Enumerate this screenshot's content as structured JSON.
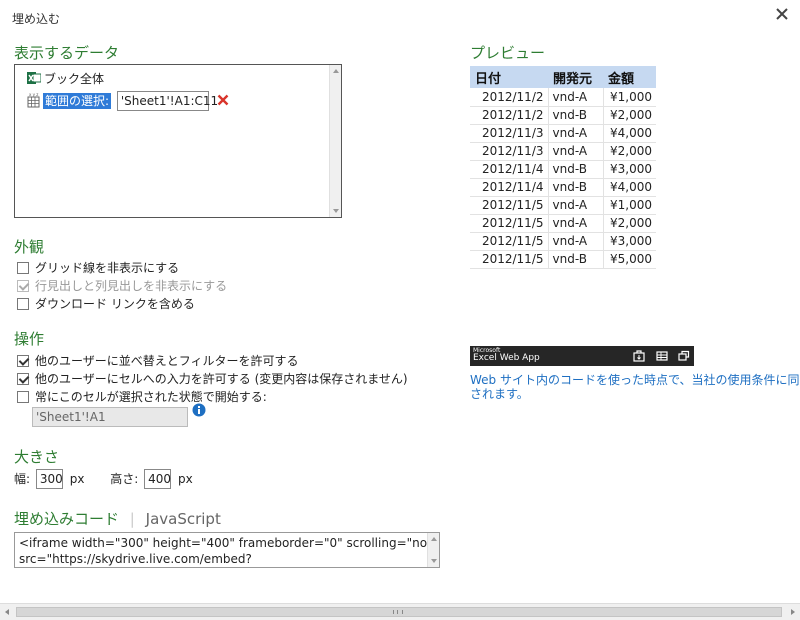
{
  "dialog": {
    "title": "埋め込む"
  },
  "data_section": {
    "heading": "表示するデータ",
    "items": [
      {
        "label": "ブック全体"
      },
      {
        "label": "範囲の選択:",
        "value": "'Sheet1'!A1:C11"
      }
    ]
  },
  "appearance": {
    "heading": "外観",
    "options": [
      {
        "label": "グリッド線を非表示にする",
        "checked": false,
        "disabled": false
      },
      {
        "label": "行見出しと列見出しを非表示にする",
        "checked": true,
        "disabled": true
      },
      {
        "label": "ダウンロード リンクを含める",
        "checked": false,
        "disabled": false
      }
    ]
  },
  "interaction": {
    "heading": "操作",
    "options": [
      {
        "label": "他のユーザーに並べ替えとフィルターを許可する",
        "checked": true
      },
      {
        "label": "他のユーザーにセルへの入力を許可する (変更内容は保存されません)",
        "checked": true
      },
      {
        "label": "常にこのセルが選択された状態で開始する:",
        "checked": false
      }
    ],
    "start_cell": "'Sheet1'!A1"
  },
  "size": {
    "heading": "大きさ",
    "width_label": "幅:",
    "width_value": "300",
    "height_label": "高さ:",
    "height_value": "400",
    "unit": "px"
  },
  "embed_code": {
    "tab_active": "埋め込みコード",
    "tab_other": "JavaScript",
    "code_line1": "<iframe width=\"300\" height=\"400\" frameborder=\"0\" scrolling=\"no\"",
    "code_line2": "src=\"https://skydrive.live.com/embed?"
  },
  "preview": {
    "heading": "プレビュー",
    "columns": [
      "日付",
      "開発元",
      "金額"
    ],
    "rows": [
      [
        "2012/11/2",
        "vnd-A",
        "¥1,000"
      ],
      [
        "2012/11/2",
        "vnd-B",
        "¥2,000"
      ],
      [
        "2012/11/3",
        "vnd-A",
        "¥4,000"
      ],
      [
        "2012/11/3",
        "vnd-A",
        "¥2,000"
      ],
      [
        "2012/11/4",
        "vnd-B",
        "¥3,000"
      ],
      [
        "2012/11/4",
        "vnd-B",
        "¥4,000"
      ],
      [
        "2012/11/5",
        "vnd-A",
        "¥1,000"
      ],
      [
        "2012/11/5",
        "vnd-A",
        "¥2,000"
      ],
      [
        "2012/11/5",
        "vnd-A",
        "¥3,000"
      ],
      [
        "2012/11/5",
        "vnd-B",
        "¥5,000"
      ]
    ]
  },
  "web_app_bar": {
    "brand_small": "Microsoft",
    "brand": "Excel Web App"
  },
  "terms": {
    "line1": "Web サイト内のコードを使った時点で、当社の使用条件に同意したものとみ",
    "line2": "されます。"
  },
  "colors": {
    "heading": "#2e7d32",
    "header_fill": "#c6d9f1",
    "link": "#1e6fc2",
    "excel_green": "#1e7145",
    "remove_red": "#d9342b"
  }
}
